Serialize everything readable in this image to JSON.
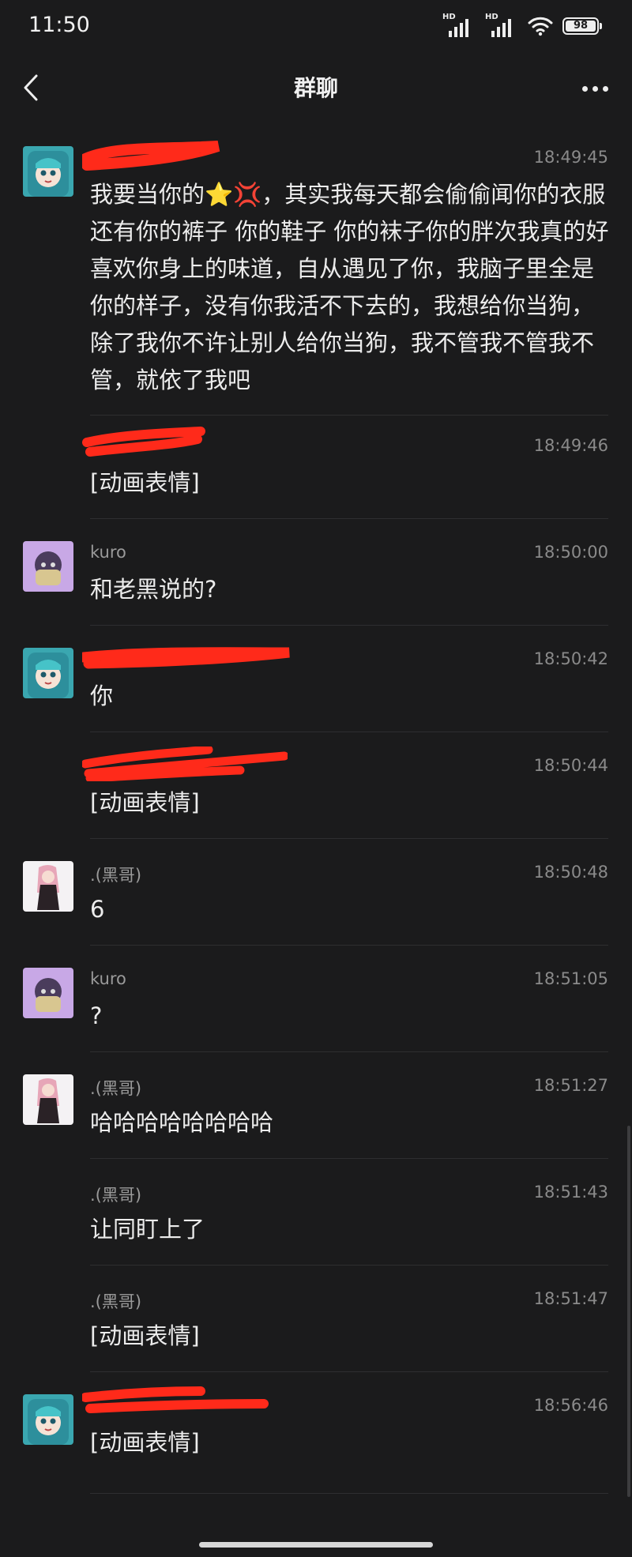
{
  "status": {
    "time": "11:50",
    "hd": "HD",
    "battery": "98"
  },
  "nav": {
    "title": "群聊"
  },
  "messages": [
    {
      "sender": "",
      "time": "18:49:45",
      "text": "我要当你的⭐💢，其实我每天都会偷偷闻你的衣服还有你的裤子 你的鞋子 你的袜子你的胖次我真的好喜欢你身上的味道，自从遇见了你，我脑子里全是你的样子，没有你我活不下去的，我想给你当狗，除了我你不许让别人给你当狗，我不管我不管我不管，就依了我吧"
    },
    {
      "sender": "",
      "time": "18:49:46",
      "text": "[动画表情]"
    },
    {
      "sender": "kuro",
      "time": "18:50:00",
      "text": "和老黑说的?"
    },
    {
      "sender": "",
      "time": "18:50:42",
      "text": "你"
    },
    {
      "sender": "",
      "time": "18:50:44",
      "text": "[动画表情]"
    },
    {
      "sender": ".(黑哥)",
      "time": "18:50:48",
      "text": "6"
    },
    {
      "sender": "kuro",
      "time": "18:51:05",
      "text": "?"
    },
    {
      "sender": ".(黑哥)",
      "time": "18:51:27",
      "text": "哈哈哈哈哈哈哈哈"
    },
    {
      "sender": ".(黑哥)",
      "time": "18:51:43",
      "text": "让同盯上了"
    },
    {
      "sender": ".(黑哥)",
      "time": "18:51:47",
      "text": "[动画表情]"
    },
    {
      "sender": "",
      "time": "18:56:46",
      "text": "[动画表情]"
    }
  ],
  "icons": [
    "signal-hd-icon",
    "wifi-icon",
    "battery-icon",
    "back-arrow-icon",
    "more-dots-icon"
  ],
  "colors": {
    "background": "#1b1b1c",
    "text": "#ececec",
    "meta": "#8a8a8a",
    "redaction": "#ff2a1a"
  }
}
